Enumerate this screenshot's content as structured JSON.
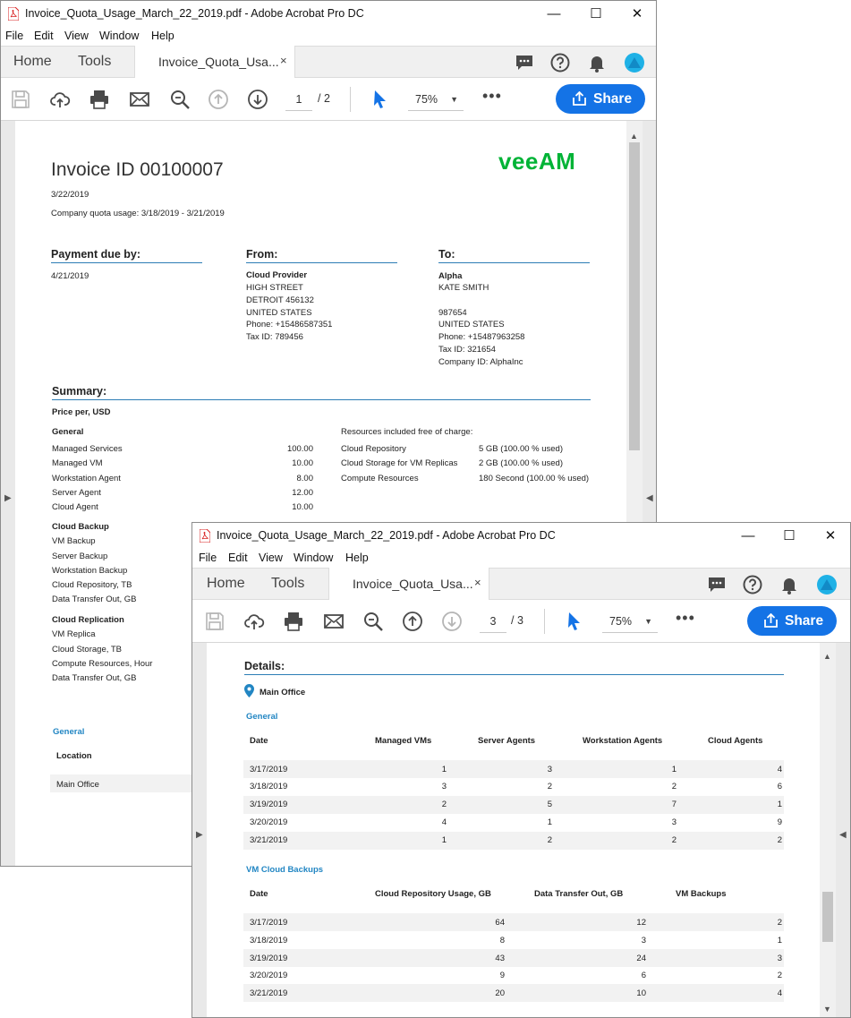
{
  "win1": {
    "title": "Invoice_Quota_Usage_March_22_2019.pdf - Adobe Acrobat Pro DC",
    "menu": [
      "File",
      "Edit",
      "View",
      "Window",
      "Help"
    ],
    "tabs": {
      "home": "Home",
      "tools": "Tools",
      "doc": "Invoice_Quota_Usa...",
      "close": "×"
    },
    "page_current": "1",
    "page_total": "/  2",
    "zoom": "75%",
    "share": "Share"
  },
  "win2": {
    "title": "Invoice_Quota_Usage_March_22_2019.pdf - Adobe Acrobat Pro DC",
    "menu": [
      "File",
      "Edit",
      "View",
      "Window",
      "Help"
    ],
    "tabs": {
      "home": "Home",
      "tools": "Tools",
      "doc": "Invoice_Quota_Usa...",
      "close": "×"
    },
    "page_current": "3",
    "page_total": "/  3",
    "zoom": "75%",
    "share": "Share"
  },
  "invoice": {
    "logo": "veeAM",
    "title": "Invoice ID 00100007",
    "date": "3/22/2019",
    "quota_usage": "Company quota usage: 3/18/2019 - 3/21/2019",
    "payment_due_label": "Payment due by:",
    "payment_due": "4/21/2019",
    "from_label": "From:",
    "from_lines": [
      "Cloud Provider",
      "HIGH STREET",
      "DETROIT 456132",
      "UNITED STATES",
      "Phone: +15486587351",
      "Tax ID: 789456"
    ],
    "to_label": "To:",
    "to_lines": [
      "Alpha",
      "KATE SMITH",
      "",
      "987654",
      "UNITED STATES",
      "Phone: +15487963258",
      "Tax ID: 321654",
      "Company ID: AlphaInc"
    ],
    "summary_label": "Summary:",
    "price_per": "Price per, USD",
    "general_label": "General",
    "general_items": [
      {
        "name": "Managed Services",
        "price": "100.00"
      },
      {
        "name": "Managed VM",
        "price": "10.00"
      },
      {
        "name": "Workstation Agent",
        "price": "8.00"
      },
      {
        "name": "Server Agent",
        "price": "12.00"
      },
      {
        "name": "Cloud Agent",
        "price": "10.00"
      }
    ],
    "free_label": "Resources included free of charge:",
    "free_items": [
      {
        "name": "Cloud Repository",
        "value": "5 GB (100.00 % used)"
      },
      {
        "name": "Cloud Storage for VM Replicas",
        "value": "2 GB (100.00 % used)"
      },
      {
        "name": "Compute Resources",
        "value": "180 Second (100.00 % used)"
      }
    ],
    "cloud_backup_label": "Cloud Backup",
    "cloud_backup_items": [
      "VM Backup",
      "Server Backup",
      "Workstation Backup",
      "Cloud Repository, TB",
      "Data Transfer Out, GB"
    ],
    "cloud_replication_label": "Cloud Replication",
    "cloud_replication_items": [
      "VM Replica",
      "Cloud Storage, TB",
      "Compute Resources, Hour",
      "Data Transfer Out, GB"
    ],
    "general_section": "General",
    "location_header": "Location",
    "location_value": "Main Office"
  },
  "details": {
    "title": "Details:",
    "office": "Main Office",
    "general_label": "General",
    "general_headers": [
      "Date",
      "Managed VMs",
      "Server Agents",
      "Workstation Agents",
      "Cloud Agents"
    ],
    "general_rows": [
      [
        "3/17/2019",
        "1",
        "3",
        "1",
        "4"
      ],
      [
        "3/18/2019",
        "3",
        "2",
        "2",
        "6"
      ],
      [
        "3/19/2019",
        "2",
        "5",
        "7",
        "1"
      ],
      [
        "3/20/2019",
        "4",
        "1",
        "3",
        "9"
      ],
      [
        "3/21/2019",
        "1",
        "2",
        "2",
        "2"
      ]
    ],
    "vm_label": "VM Cloud Backups",
    "vm_headers": [
      "Date",
      "Cloud Repository Usage, GB",
      "Data Transfer Out, GB",
      "VM Backups"
    ],
    "vm_rows": [
      [
        "3/17/2019",
        "64",
        "12",
        "2"
      ],
      [
        "3/18/2019",
        "8",
        "3",
        "1"
      ],
      [
        "3/19/2019",
        "43",
        "24",
        "3"
      ],
      [
        "3/20/2019",
        "9",
        "6",
        "2"
      ],
      [
        "3/21/2019",
        "20",
        "10",
        "4"
      ]
    ]
  },
  "colors": {
    "accent": "#1473e6",
    "veeam_green": "#00b336",
    "section_blue": "#2286c3"
  }
}
